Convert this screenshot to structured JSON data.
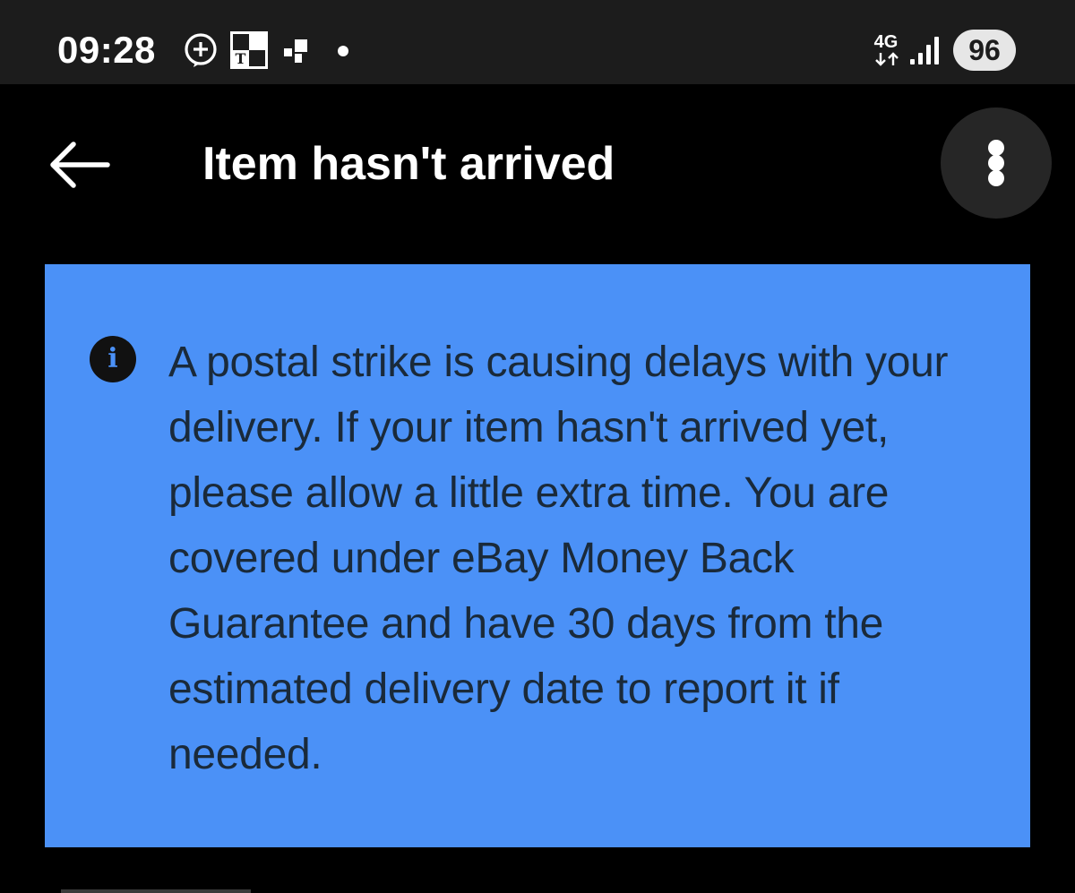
{
  "status_bar": {
    "time": "09:28",
    "notification_icons": [
      "plus-bubble-icon",
      "nyt-games-icon",
      "squares-icon",
      "notification-dot-icon"
    ],
    "network_type": "4G",
    "battery_level": "96"
  },
  "header": {
    "title": "Item hasn't arrived",
    "back_icon": "back-arrow-icon",
    "more_icon": "more-vertical-icon"
  },
  "banner": {
    "icon": "info-icon",
    "icon_glyph": "i",
    "text": "A postal strike is causing delays with your delivery. If your item hasn't arrived yet, please allow a little extra time. You are covered under eBay Money Back Guarantee and have 30 days from the estimated delivery date to report it if needed.",
    "background_color": "#4b91f7",
    "text_color": "#1a2a3a"
  }
}
